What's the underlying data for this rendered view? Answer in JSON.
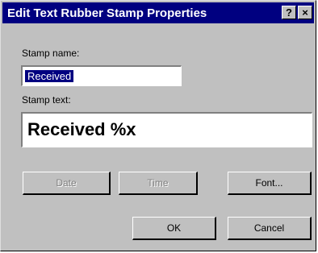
{
  "window": {
    "title": "Edit Text Rubber Stamp Properties",
    "help_glyph": "?",
    "close_glyph": "×"
  },
  "stamp_name": {
    "label": "Stamp name:",
    "value": "Received"
  },
  "stamp_text": {
    "label": "Stamp text:",
    "value": "Received %x"
  },
  "buttons": {
    "date": "Date",
    "time": "Time",
    "font": "Font...",
    "ok": "OK",
    "cancel": "Cancel"
  },
  "colors": {
    "titlebar": "#000080",
    "face": "#c0c0c0",
    "selection": "#000080"
  }
}
